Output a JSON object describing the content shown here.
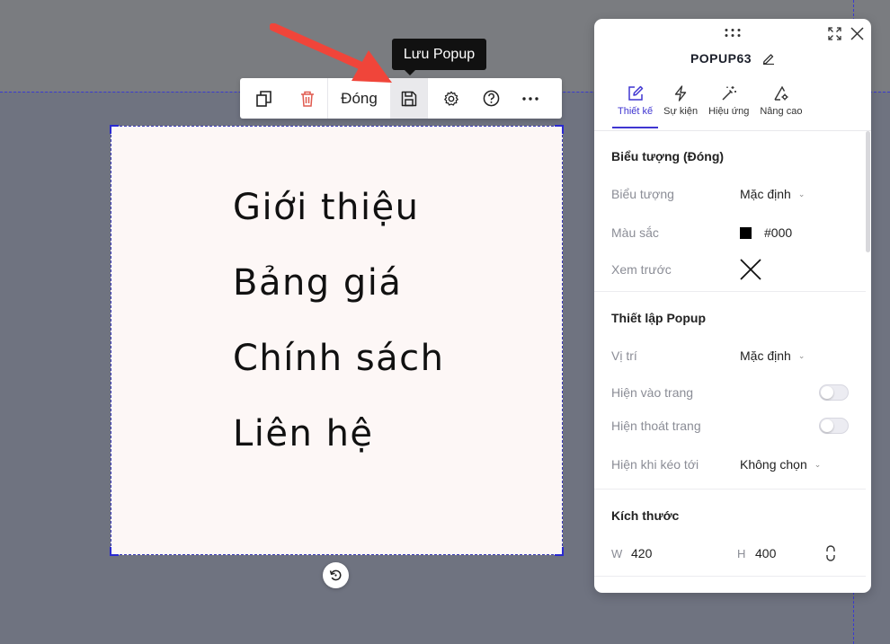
{
  "canvas": {
    "menu_items": [
      "Giới thiệu",
      "Bảng giá",
      "Chính sách",
      "Liên hệ"
    ]
  },
  "toolbar": {
    "close_label": "Đóng",
    "tooltip": "Lưu Popup"
  },
  "panel": {
    "title": "POPUP63",
    "tabs": [
      "Thiết kế",
      "Sự kiện",
      "Hiệu ứng",
      "Nâng cao"
    ],
    "icon_section": {
      "title": "Biểu tượng (Đóng)",
      "icon_label": "Biểu tượng",
      "icon_value": "Mặc định",
      "color_label": "Màu sắc",
      "color_value": "#000",
      "preview_label": "Xem trước"
    },
    "popup_section": {
      "title": "Thiết lập Popup",
      "position_label": "Vị trí",
      "position_value": "Mặc định",
      "show_on_enter_label": "Hiện vào trang",
      "show_on_exit_label": "Hiện thoát trang",
      "show_on_scroll_label": "Hiện khi kéo tới",
      "show_on_scroll_value": "Không chọn"
    },
    "size_section": {
      "title": "Kích thước",
      "w_label": "W",
      "w_value": "420",
      "h_label": "H",
      "h_value": "400"
    }
  },
  "colors": {
    "accent": "#3f35d1",
    "canvas_bg": "#fdf7f6",
    "workspace_bg": "#6f7380",
    "delete_red": "#e05a4e",
    "pointer_red": "#f0453a"
  }
}
